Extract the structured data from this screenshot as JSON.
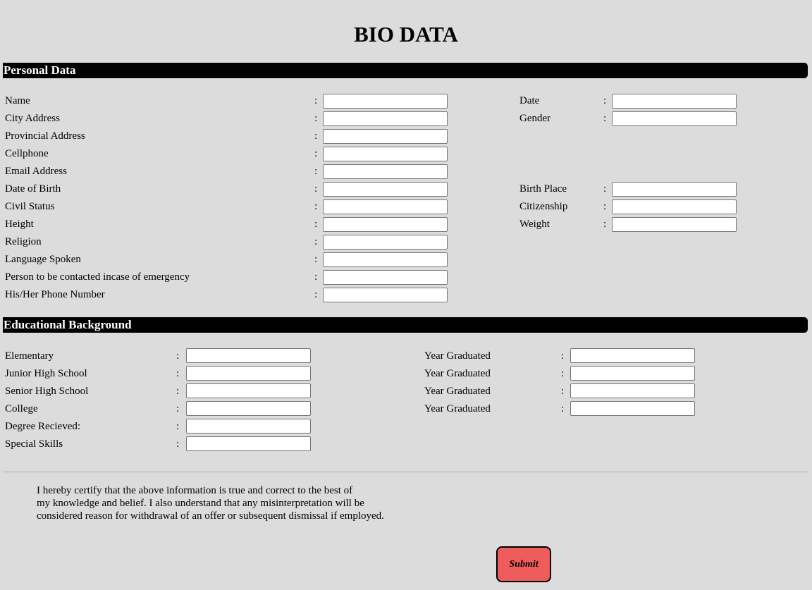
{
  "page_title": "BIO DATA",
  "personal": {
    "heading": "Personal Data",
    "name": "Name",
    "city_address": "City Address",
    "provincial_address": "Provincial Address",
    "cellphone": "Cellphone",
    "email_address": "Email Address",
    "date_of_birth": "Date of Birth",
    "civil_status": "Civil Status",
    "height": "Height",
    "religion": "Religion",
    "language_spoken": "Language Spoken",
    "emergency_contact": "Person to be contacted incase of emergency",
    "emergency_phone": "His/Her Phone Number",
    "date": "Date",
    "gender": "Gender",
    "birth_place": "Birth Place",
    "citizenship": "Citizenship",
    "weight": "Weight"
  },
  "education": {
    "heading": "Educational Background",
    "elementary": "Elementary",
    "junior_high": "Junior High School",
    "senior_high": "Senior High School",
    "college": "College",
    "degree": "Degree Recieved:",
    "special_skills": "Special Skills",
    "year_graduated": "Year Graduated"
  },
  "separator": ":",
  "certification": {
    "line1": "I hereby certify that the above information is true and correct to the best of",
    "line2": "my knowledge and belief. I also understand that any misinterpretation will be",
    "line3": "considered reason for withdrawal of an offer or subsequent dismissal if employed."
  },
  "submit_label": "Submit"
}
